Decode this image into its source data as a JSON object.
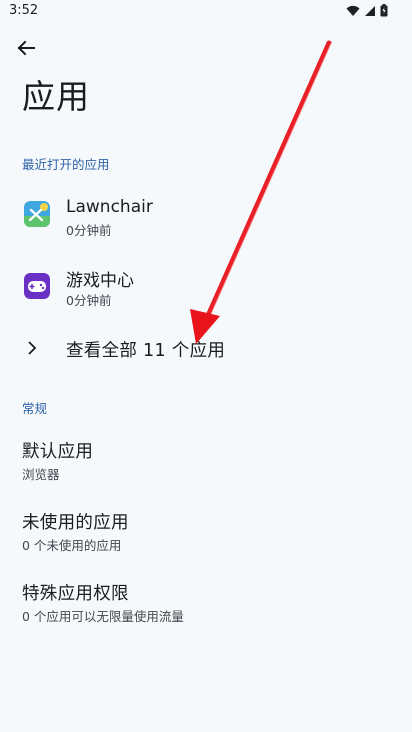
{
  "status_bar": {
    "time": "3:52"
  },
  "header": {
    "title": "应用"
  },
  "sections": {
    "recent_label": "最近打开的应用",
    "general_label": "常规"
  },
  "recent_apps": [
    {
      "name": "Lawnchair",
      "sub": "0分钟前",
      "icon": "lawnchair-icon"
    },
    {
      "name": "游戏中心",
      "sub": "0分钟前",
      "icon": "game-center-icon"
    }
  ],
  "see_all_label": "查看全部 11 个应用",
  "general_items": [
    {
      "title": "默认应用",
      "sub": "浏览器"
    },
    {
      "title": "未使用的应用",
      "sub": "0 个未使用的应用"
    },
    {
      "title": "特殊应用权限",
      "sub": "0 个应用可以无限量使用流量"
    }
  ],
  "colors": {
    "background": "#f6f9fc",
    "section_header": "#2f63a8",
    "annotation_arrow": "#e8141c"
  }
}
